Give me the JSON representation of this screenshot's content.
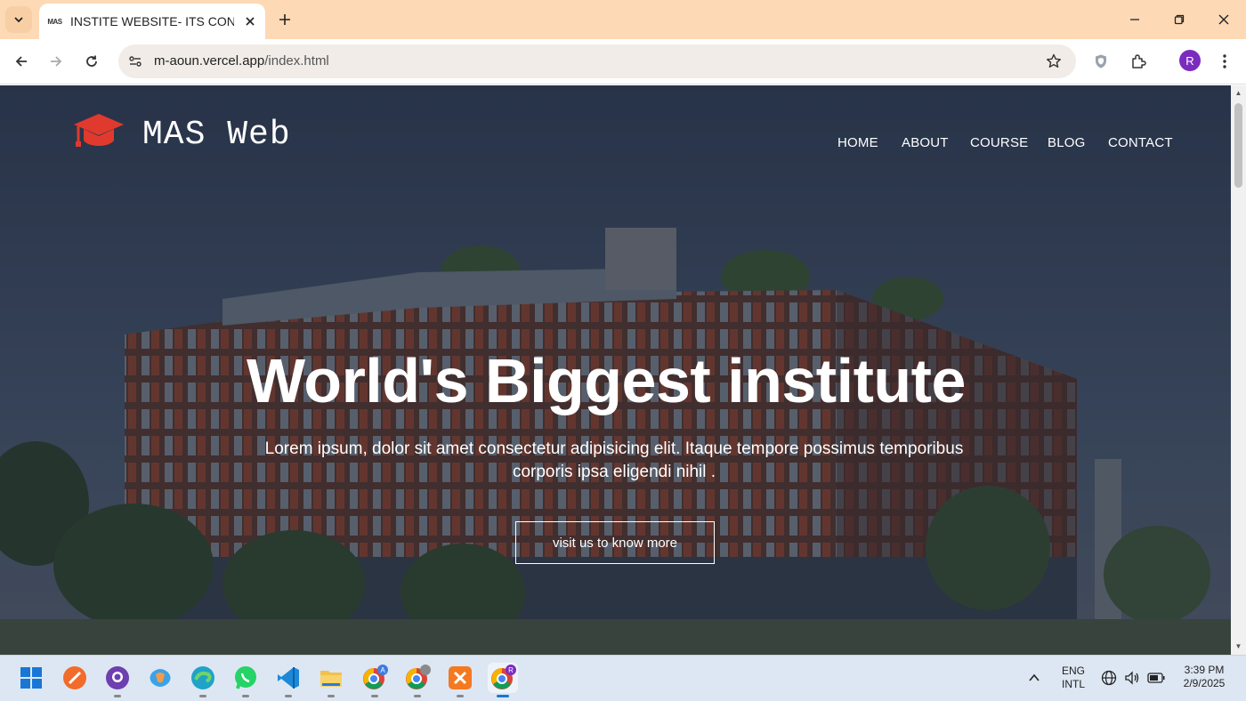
{
  "browser": {
    "tab_favicon_text": "MAS",
    "tab_title": "INSTITE WEBSITE- ITS CONTENT",
    "url_host": "m-aoun.vercel.app",
    "url_path": "/index.html",
    "profile_initial": "R"
  },
  "site": {
    "logo_text": "MAS Web",
    "nav": [
      "HOME",
      "ABOUT",
      "COURSE",
      "BLOG",
      "CONTACT"
    ],
    "hero_title": "World's Biggest institute",
    "hero_subtitle": "Lorem ipsum, dolor sit amet consectetur adipisicing elit. Itaque tempore possimus temporibus corporis ipsa eligendi nihil .",
    "cta_label": "visit us to know more"
  },
  "taskbar": {
    "apps": [
      "windows-start",
      "app-orange",
      "github-desktop",
      "copilot",
      "edge",
      "whatsapp",
      "vscode",
      "file-explorer",
      "chrome-profile-a",
      "chrome-profile-b",
      "xampp",
      "chrome-profile-r"
    ],
    "lang_line1": "ENG",
    "lang_line2": "INTL",
    "time": "3:39 PM",
    "date": "2/9/2025"
  },
  "colors": {
    "accent_red": "#e03a2f",
    "tabstrip": "#fdd9b5"
  }
}
